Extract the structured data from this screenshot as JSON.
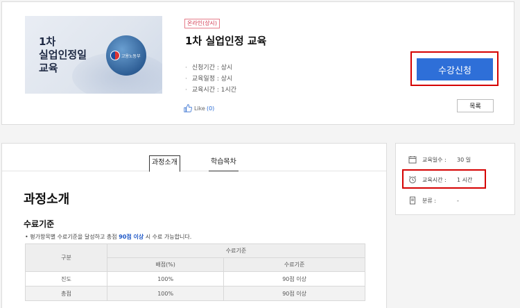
{
  "course": {
    "thumbnail_title": "1차\n실업인정일\n교육",
    "thumbnail_emblem_text": "고용노동부",
    "badge": "온라인(상시)",
    "title": "1차 실업인정 교육",
    "info": [
      "신청기간 : 상시",
      "교육일정 : 상시",
      "교육시간 : 1시간"
    ],
    "like_label": "Like",
    "like_count": "(0)",
    "apply_label": "수강신청",
    "list_label": "목록"
  },
  "tabs": [
    {
      "label": "과정소개",
      "active": true
    },
    {
      "label": "학습목차",
      "active": false
    }
  ],
  "intro": {
    "section_title": "과정소개",
    "criteria_title": "수료기준",
    "note_prefix": "• 평가항목별 수료기준을 달성하고 총점 ",
    "note_strong": "90점 이상",
    "note_suffix": " 시 수료 가능합니다.",
    "table": {
      "header_group": "구분",
      "header_main": "수료기준",
      "header_sub1": "배점(%)",
      "header_sub2": "수료기준",
      "rows": [
        {
          "label": "진도",
          "score": "100%",
          "criteria": "90점 이상"
        },
        {
          "label": "총점",
          "score": "100%",
          "criteria": "90점 이상"
        }
      ]
    }
  },
  "side": {
    "days_label": "교육일수 :",
    "days_value": "30 일",
    "hours_label": "교육시간 :",
    "hours_value": "1 시간",
    "category_label": "분류 :",
    "category_value": "-"
  },
  "colors": {
    "accent": "#2e6fd8",
    "highlight": "#d50000",
    "badge": "#d2374f"
  }
}
